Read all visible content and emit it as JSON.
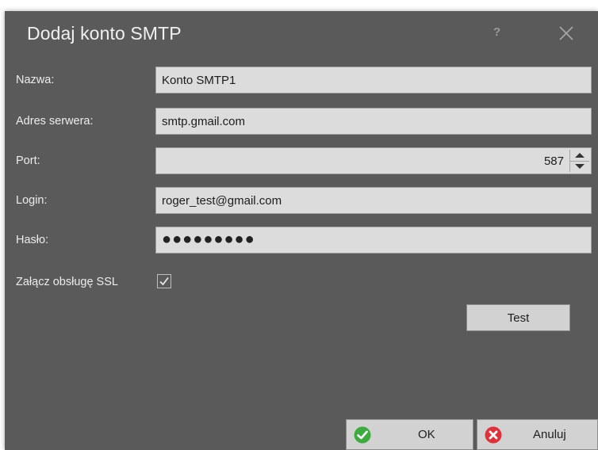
{
  "dialog": {
    "title": "Dodaj konto SMTP",
    "help_label": "?",
    "background_color": "#5a5a5a"
  },
  "form": {
    "name": {
      "label": "Nazwa:",
      "value": "Konto SMTP1"
    },
    "server": {
      "label": "Adres serwera:",
      "value": "smtp.gmail.com"
    },
    "port": {
      "label": "Port:",
      "value": "587"
    },
    "login": {
      "label": "Login:",
      "value": "roger_test@gmail.com"
    },
    "password": {
      "label": "Hasło:",
      "value": "●●●●●●●●●"
    },
    "ssl": {
      "label": "Załącz obsługę SSL",
      "checked": true
    }
  },
  "buttons": {
    "test": "Test",
    "ok": {
      "label": "OK",
      "icon": "check-circle-icon",
      "color": "#3dab3d"
    },
    "cancel": {
      "label": "Anuluj",
      "icon": "x-circle-icon",
      "color": "#e0303a"
    }
  }
}
